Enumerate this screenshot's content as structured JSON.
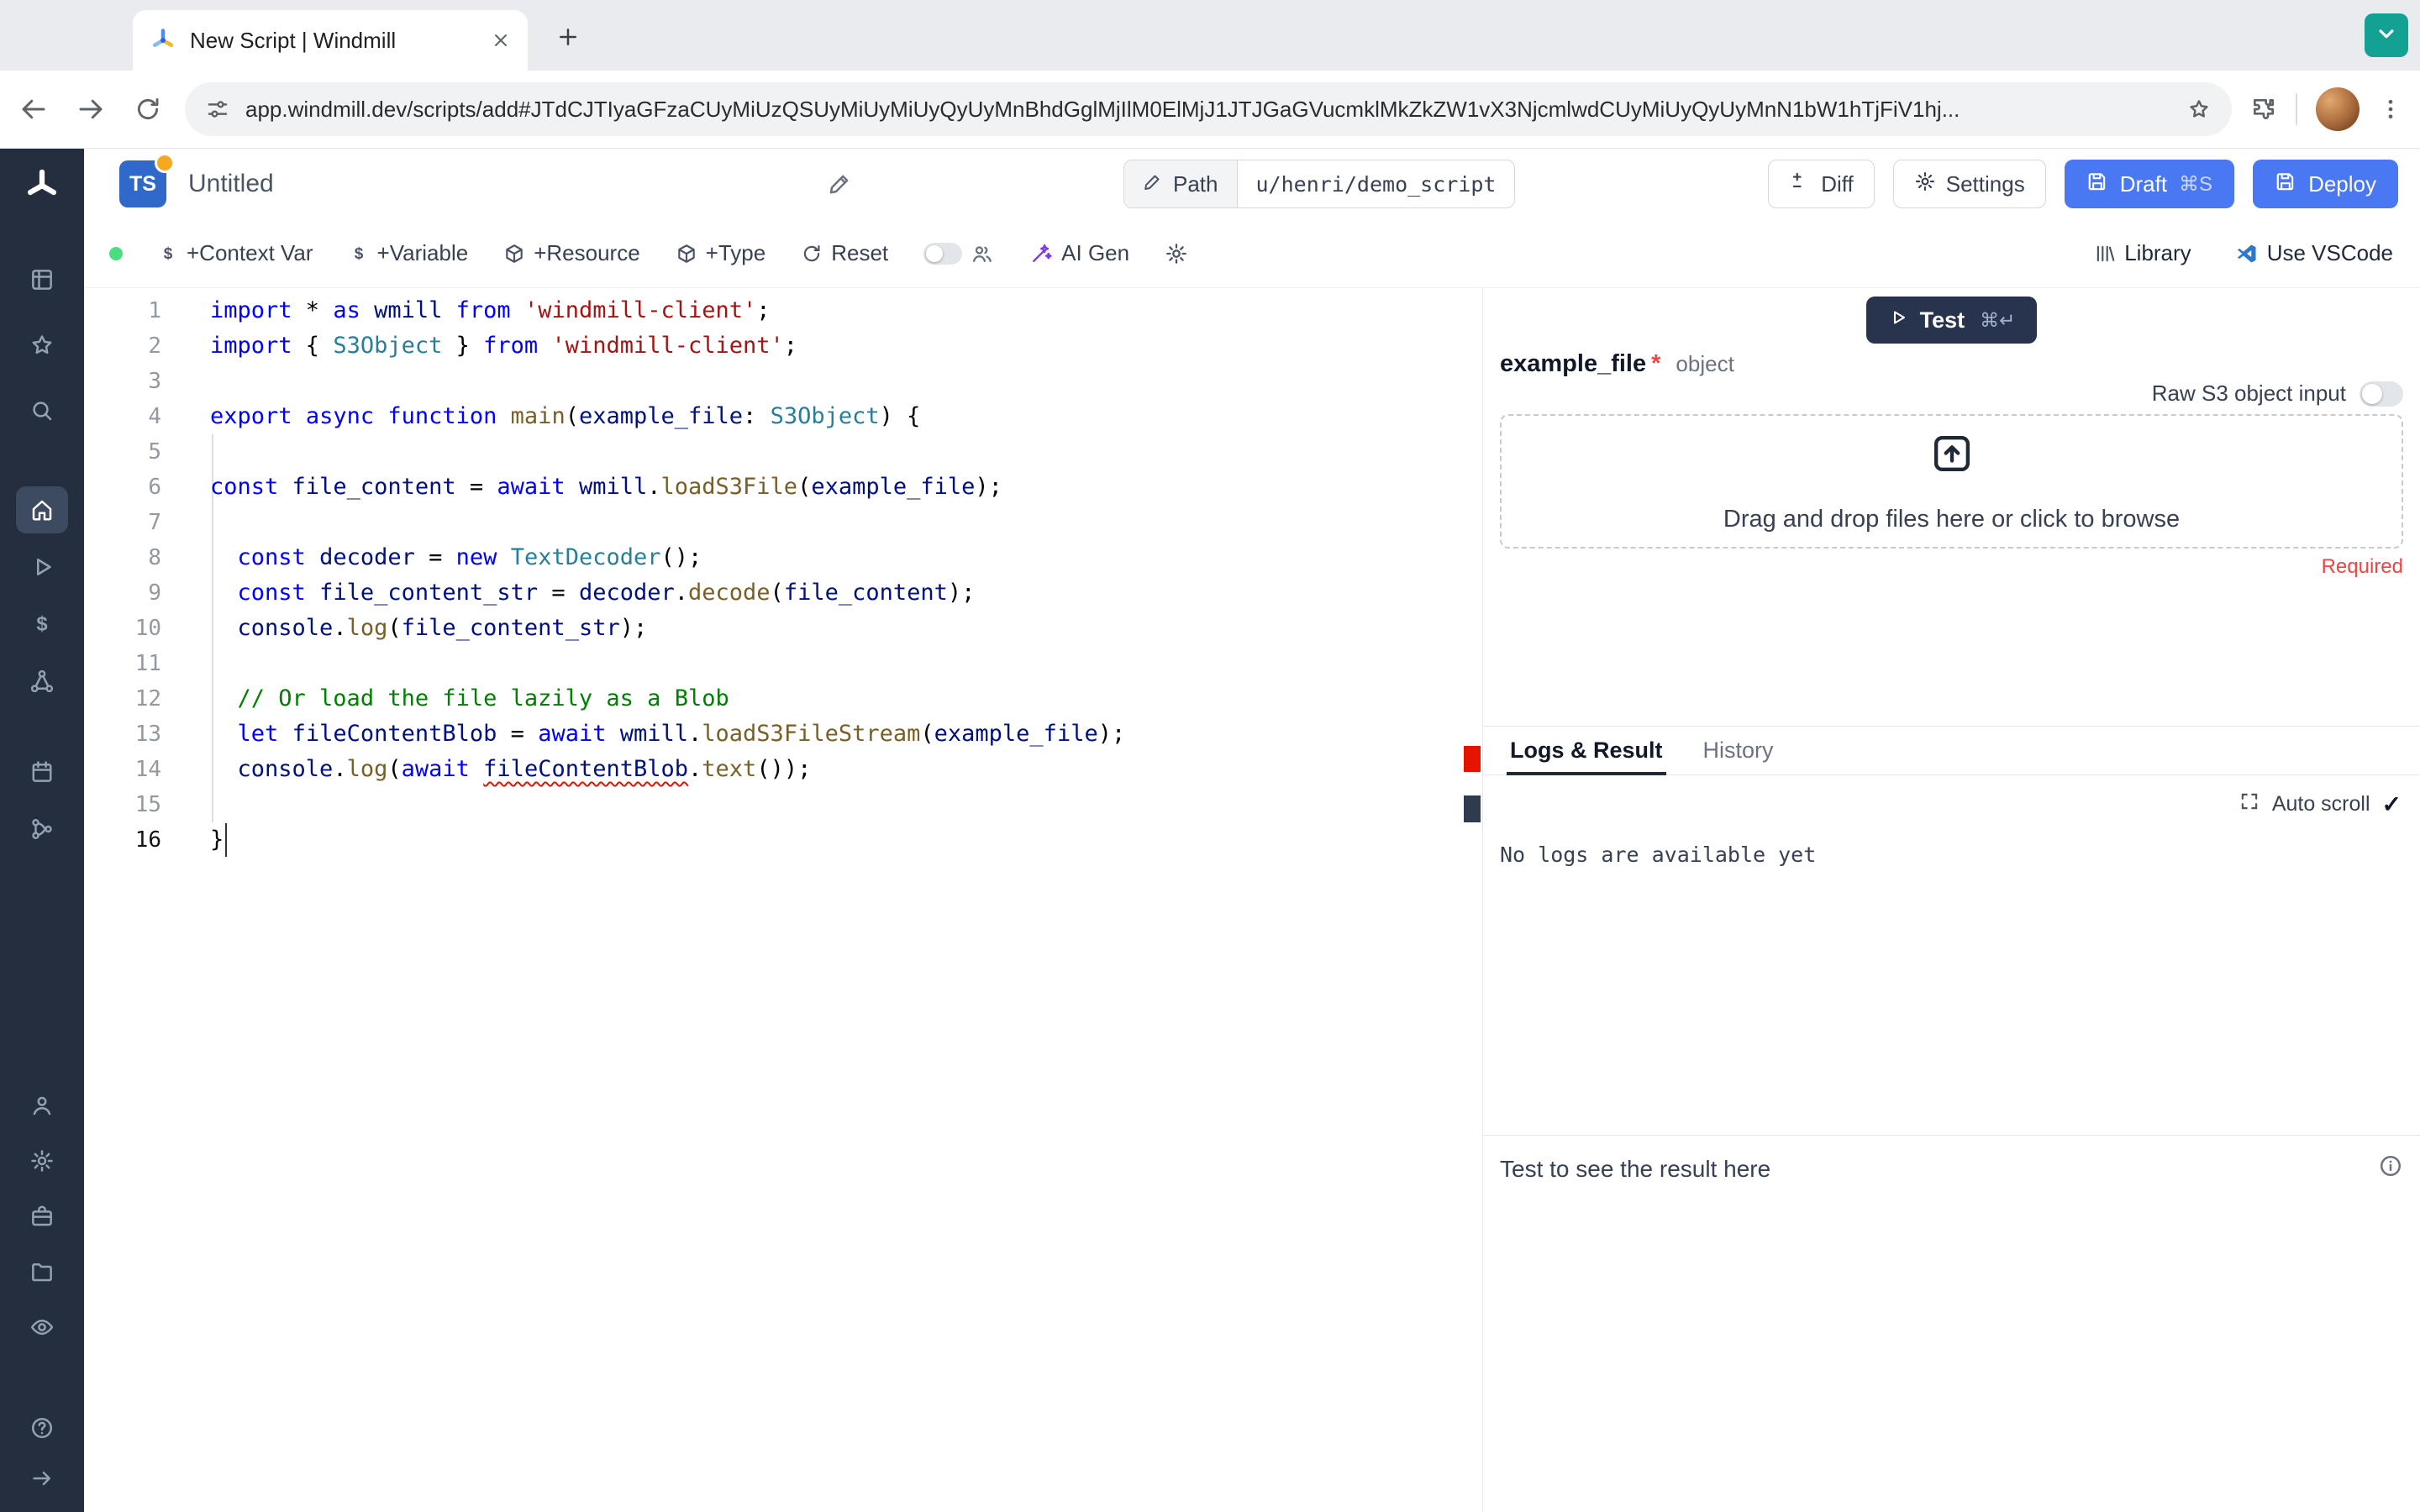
{
  "colors": {
    "accent_blue": "#4a78f2",
    "rail_background": "#242e3f",
    "rail_active_background": "#3d4b61",
    "teal_browser_button": "#12a192",
    "green_status_dot": "#4ade80",
    "error_red": "#e51400",
    "required_red": "#ef4444",
    "test_button": "#28344e",
    "ts_badge_blue": "#3069c9",
    "overview_cursor": "#2f3b4f"
  },
  "browser": {
    "tab_title": "New Script | Windmill",
    "url": "app.windmill.dev/scripts/add#JTdCJTIyaGFzaCUyMiUzQSUyMiUyMiUyQyUyMnBhdGglMjIlM0ElMjJ1JTJGaGVucmklMkZkZW1vX3NjcmlwdCUyMiUyQyUyMnN1bW1hTjFiV1hj..."
  },
  "header": {
    "lang_badge": "TS",
    "title": "Untitled",
    "path_label": "Path",
    "path_value": "u/henri/demo_script",
    "diff_label": "Diff",
    "settings_label": "Settings",
    "draft_label": "Draft",
    "draft_shortcut": "⌘S",
    "deploy_label": "Deploy"
  },
  "toolbar": {
    "context_var": "+Context Var",
    "variable": "+Variable",
    "resource": "+Resource",
    "type": "+Type",
    "reset": "Reset",
    "ai_gen": "AI Gen",
    "library": "Library",
    "vscode": "Use VSCode"
  },
  "sidebar": {
    "groups": [
      {
        "cls": "g1",
        "items": [
          {
            "name": "apps-icon",
            "icon": "grid"
          },
          {
            "name": "favorites-icon",
            "icon": "star"
          },
          {
            "name": "search-icon",
            "icon": "search"
          }
        ]
      },
      {
        "cls": "g2",
        "items": [
          {
            "name": "home-icon",
            "icon": "home",
            "active": true
          },
          {
            "name": "runs-icon",
            "icon": "play"
          },
          {
            "name": "variables-icon",
            "icon": "dollar"
          },
          {
            "name": "resources-icon",
            "icon": "hub"
          }
        ]
      },
      {
        "cls": "g3",
        "items": [
          {
            "name": "schedules-icon",
            "icon": "calendar"
          },
          {
            "name": "flows-icon",
            "icon": "branch"
          }
        ]
      },
      {
        "cls": "g4",
        "items": [
          {
            "name": "user-icon",
            "icon": "user"
          },
          {
            "name": "settings-icon",
            "icon": "gear"
          },
          {
            "name": "workers-icon",
            "icon": "briefcase"
          },
          {
            "name": "folders-icon",
            "icon": "folder"
          },
          {
            "name": "audit-icon",
            "icon": "eye"
          }
        ]
      },
      {
        "cls": "g5",
        "items": [
          {
            "name": "help-icon",
            "icon": "help"
          },
          {
            "name": "collapse-icon",
            "icon": "arrow-right"
          }
        ]
      }
    ]
  },
  "editor": {
    "active_line": 16,
    "colors": {
      "keyword": "#0000ff",
      "string": "#a31515",
      "type": "#267f99",
      "function": "#795e26",
      "variable": "#001080",
      "comment": "#008000",
      "plain": "#000000"
    },
    "lines": [
      [
        [
          "keyword",
          "import"
        ],
        [
          "plain",
          " * "
        ],
        [
          "keyword",
          "as"
        ],
        [
          "plain",
          " "
        ],
        [
          "variable",
          "wmill"
        ],
        [
          "plain",
          " "
        ],
        [
          "keyword",
          "from"
        ],
        [
          "plain",
          " "
        ],
        [
          "string",
          "'windmill-client'"
        ],
        [
          "plain",
          ";"
        ]
      ],
      [
        [
          "keyword",
          "import"
        ],
        [
          "plain",
          " { "
        ],
        [
          "type",
          "S3Object"
        ],
        [
          "plain",
          " } "
        ],
        [
          "keyword",
          "from"
        ],
        [
          "plain",
          " "
        ],
        [
          "string",
          "'windmill-client'"
        ],
        [
          "plain",
          ";"
        ]
      ],
      [],
      [
        [
          "keyword",
          "export"
        ],
        [
          "plain",
          " "
        ],
        [
          "keyword",
          "async"
        ],
        [
          "plain",
          " "
        ],
        [
          "keyword",
          "function"
        ],
        [
          "plain",
          " "
        ],
        [
          "function",
          "main"
        ],
        [
          "plain",
          "("
        ],
        [
          "variable",
          "example_file"
        ],
        [
          "plain",
          ": "
        ],
        [
          "type",
          "S3Object"
        ],
        [
          "plain",
          ") {"
        ]
      ],
      [],
      [
        [
          "keyword",
          "const"
        ],
        [
          "plain",
          " "
        ],
        [
          "variable",
          "file_content"
        ],
        [
          "plain",
          " = "
        ],
        [
          "keyword",
          "await"
        ],
        [
          "plain",
          " "
        ],
        [
          "variable",
          "wmill"
        ],
        [
          "plain",
          "."
        ],
        [
          "function",
          "loadS3File"
        ],
        [
          "plain",
          "("
        ],
        [
          "variable",
          "example_file"
        ],
        [
          "plain",
          ");"
        ]
      ],
      [],
      [
        [
          "plain",
          "  "
        ],
        [
          "keyword",
          "const"
        ],
        [
          "plain",
          " "
        ],
        [
          "variable",
          "decoder"
        ],
        [
          "plain",
          " = "
        ],
        [
          "keyword",
          "new"
        ],
        [
          "plain",
          " "
        ],
        [
          "type",
          "TextDecoder"
        ],
        [
          "plain",
          "();"
        ]
      ],
      [
        [
          "plain",
          "  "
        ],
        [
          "keyword",
          "const"
        ],
        [
          "plain",
          " "
        ],
        [
          "variable",
          "file_content_str"
        ],
        [
          "plain",
          " = "
        ],
        [
          "variable",
          "decoder"
        ],
        [
          "plain",
          "."
        ],
        [
          "function",
          "decode"
        ],
        [
          "plain",
          "("
        ],
        [
          "variable",
          "file_content"
        ],
        [
          "plain",
          ");"
        ]
      ],
      [
        [
          "plain",
          "  "
        ],
        [
          "variable",
          "console"
        ],
        [
          "plain",
          "."
        ],
        [
          "function",
          "log"
        ],
        [
          "plain",
          "("
        ],
        [
          "variable",
          "file_content_str"
        ],
        [
          "plain",
          ");"
        ]
      ],
      [],
      [
        [
          "plain",
          "  "
        ],
        [
          "comment",
          "// Or load the file lazily as a Blob"
        ]
      ],
      [
        [
          "plain",
          "  "
        ],
        [
          "keyword",
          "let"
        ],
        [
          "plain",
          " "
        ],
        [
          "variable",
          "fileContentBlob"
        ],
        [
          "plain",
          " = "
        ],
        [
          "keyword",
          "await"
        ],
        [
          "plain",
          " "
        ],
        [
          "variable",
          "wmill"
        ],
        [
          "plain",
          "."
        ],
        [
          "function",
          "loadS3FileStream"
        ],
        [
          "plain",
          "("
        ],
        [
          "variable",
          "example_file"
        ],
        [
          "plain",
          ");"
        ]
      ],
      [
        [
          "plain",
          "  "
        ],
        [
          "variable",
          "console"
        ],
        [
          "plain",
          "."
        ],
        [
          "function",
          "log"
        ],
        [
          "plain",
          "("
        ],
        [
          "keyword",
          "await"
        ],
        [
          "plain",
          " "
        ],
        [
          "variable",
          "fileContentBlob",
          "error"
        ],
        [
          "plain",
          "."
        ],
        [
          "function",
          "text"
        ],
        [
          "plain",
          "());"
        ]
      ],
      [],
      [
        [
          "plain",
          "}"
        ]
      ]
    ]
  },
  "panel": {
    "test_label": "Test",
    "test_shortcut": "⌘↵",
    "arg_name": "example_file",
    "arg_required_mark": "*",
    "arg_type": "object",
    "raw_s3_label": "Raw S3 object input",
    "dropzone_text": "Drag and drop files here or click to browse",
    "required_label": "Required",
    "tabs": [
      "Logs & Result",
      "History"
    ],
    "auto_scroll_label": "Auto scroll",
    "auto_scroll_check": "✓",
    "no_logs_text": "No logs are available yet",
    "result_placeholder": "Test to see the result here"
  }
}
